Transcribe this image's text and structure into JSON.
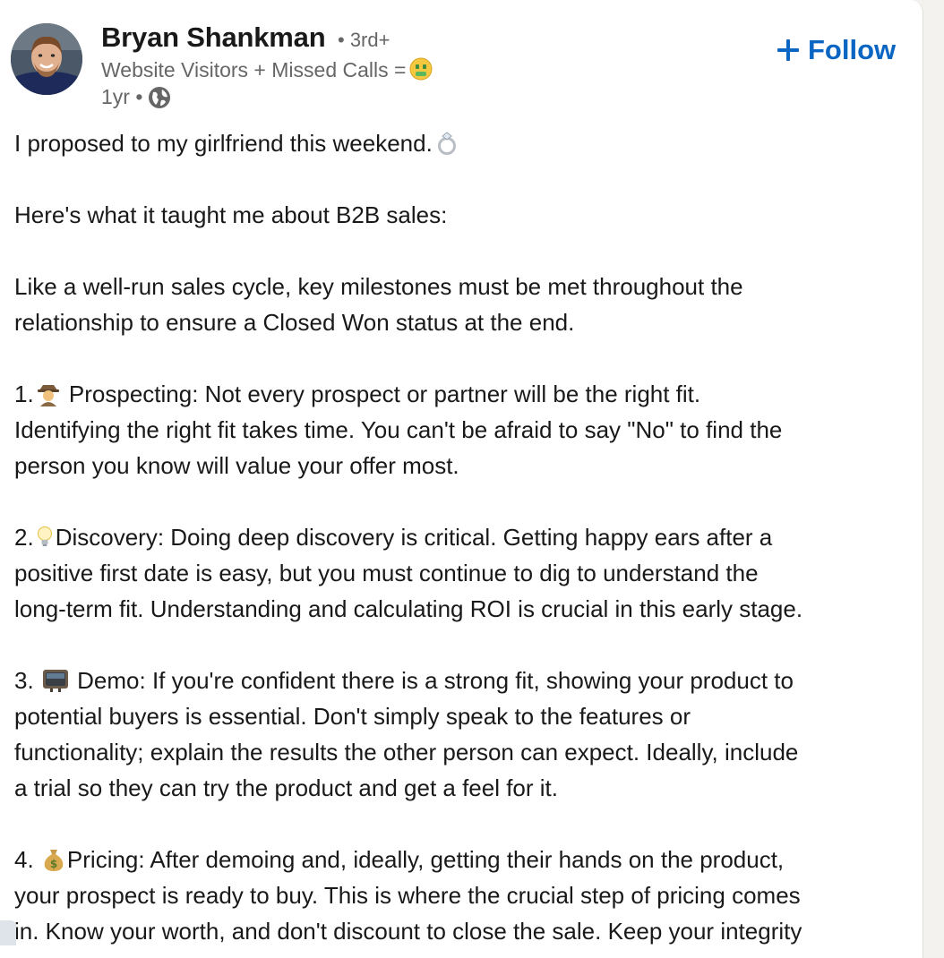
{
  "post": {
    "author": {
      "name": "Bryan Shankman",
      "degree": "• 3rd+",
      "headline": "Website Visitors + Missed Calls =",
      "headline_emoji_icon": "money-mouth-face-icon",
      "time": "1yr •",
      "visibility_icon": "globe-icon"
    },
    "follow_label": "Follow",
    "accent_color": "#0a66c2",
    "body": {
      "l1": "I proposed to my girlfriend this weekend.",
      "l2": "Here's what it taught me about B2B sales:",
      "l3a": "Like a well-run sales cycle, key milestones must be met throughout the",
      "l3b": "relationship to ensure a Closed Won status at the end.",
      "p1_num": "1.",
      "p1a": "Prospecting: Not every prospect or partner will be the right fit.",
      "p1b": "Identifying the right fit takes time. You can't be afraid to say \"No\" to find the",
      "p1c": "person you know will value your offer most.",
      "p2_num": "2.",
      "p2a": "Discovery: Doing deep discovery is critical. Getting happy ears after a",
      "p2b": "positive first date is easy, but you must continue to dig to understand the",
      "p2c": "long-term fit. Understanding and calculating ROI is crucial in this early stage.",
      "p3_num": "3.",
      "p3a": "Demo: If you're confident there is a strong fit, showing your product to",
      "p3b": "potential buyers is essential. Don't simply speak to the features or",
      "p3c": "functionality; explain the results the other person can expect. Ideally, include",
      "p3d": "a trial so they can try the product and get a feel for it.",
      "p4_num": "4.",
      "p4a": "Pricing: After demoing and, ideally, getting their hands on the product,",
      "p4b": "your prospect is ready to buy. This is where the crucial step of pricing comes",
      "p4c": "in. Know your worth, and don't discount to close the sale. Keep your integrity"
    }
  }
}
